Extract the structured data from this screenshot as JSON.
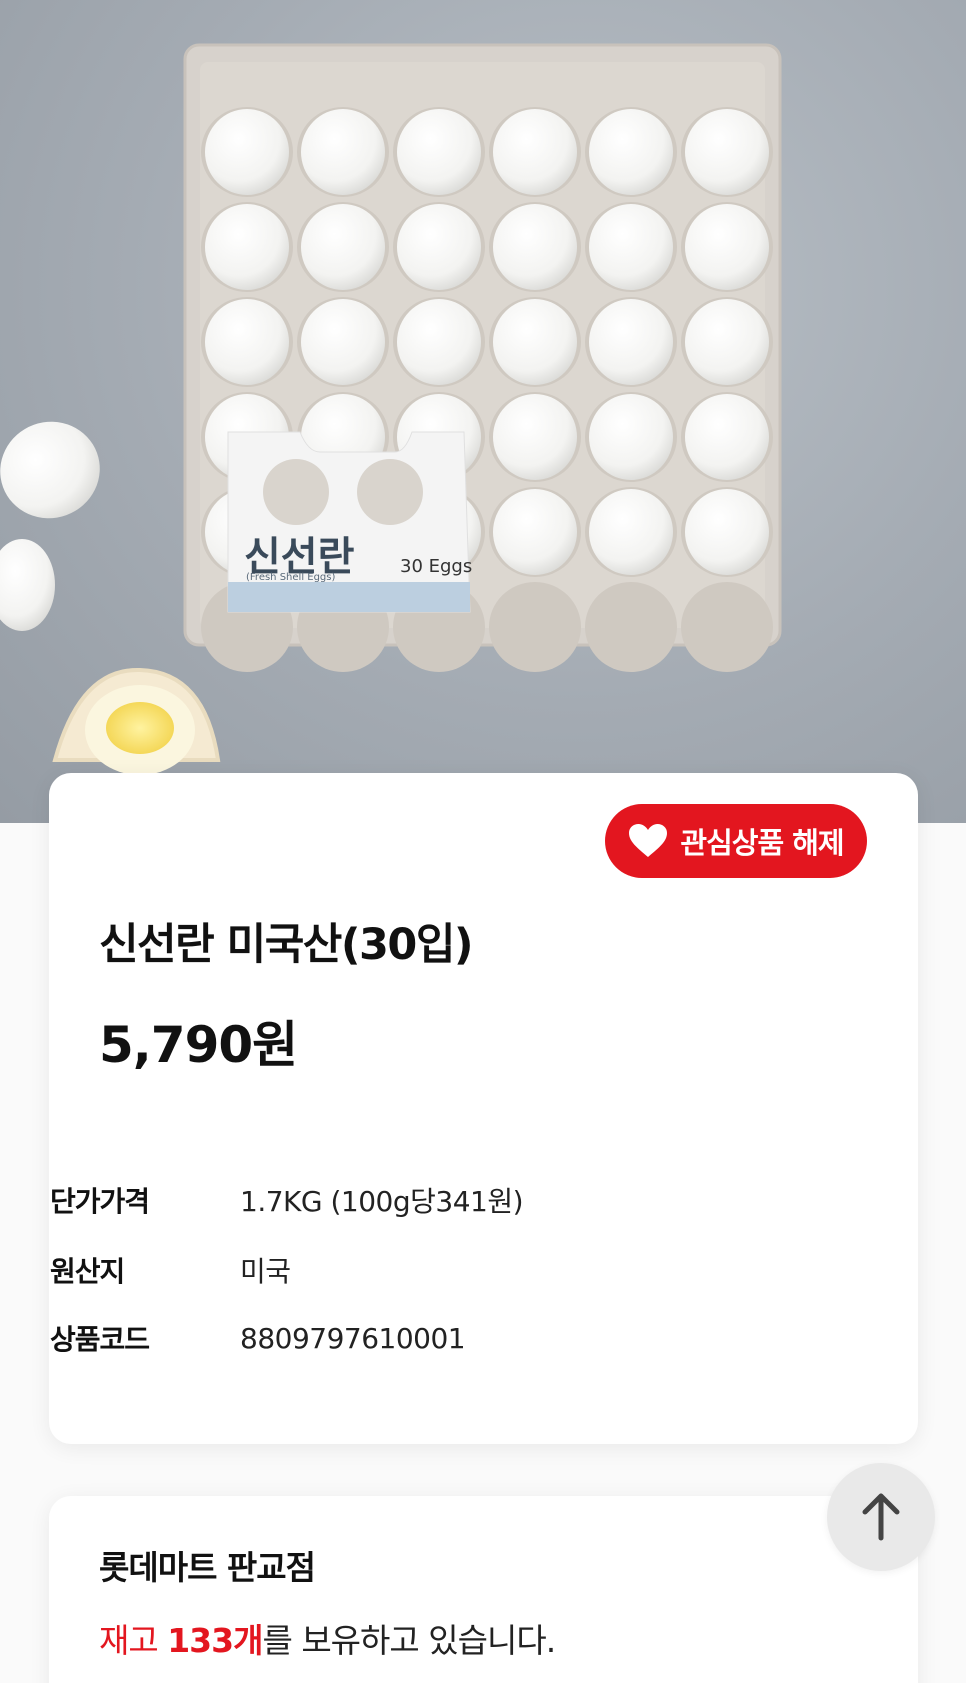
{
  "product": {
    "image_alt": "신선란 30입 계란 한 판",
    "package_label": {
      "brand": "신선란",
      "sub": "(Fresh Shell Eggs)",
      "count": "30 Eggs"
    },
    "wish_button_label": "관심상품 해제",
    "title": "신선란 미국산(30입)",
    "price": "5,790원",
    "specs": [
      {
        "label": "단가가격",
        "value": "1.7KG (100g당341원)"
      },
      {
        "label": "원산지",
        "value": "미국"
      },
      {
        "label": "상품코드",
        "value": "8809797610001"
      }
    ]
  },
  "store": {
    "name": "롯데마트 판교점",
    "stock_prefix": "재고 ",
    "stock_count": "133개",
    "stock_suffix": "를 보유하고 있습니다."
  },
  "colors": {
    "accent": "#e3161f",
    "background": "#fafafa",
    "card": "#ffffff"
  },
  "icons": {
    "wish": "heart-icon",
    "scroll_top": "arrow-up-icon"
  }
}
